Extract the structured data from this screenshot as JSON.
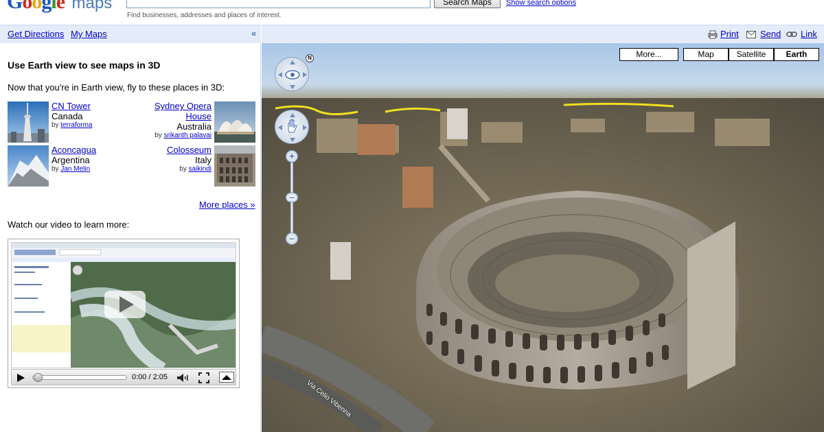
{
  "header": {
    "logo_google": "Google",
    "logo_maps": "maps",
    "search_value": "",
    "search_button": "Search Maps",
    "search_options": "Show search options",
    "search_hint": "Find businesses, addresses and places of interest."
  },
  "panel_bar": {
    "get_directions": "Get Directions",
    "my_maps": "My Maps",
    "collapse": "«"
  },
  "panel": {
    "title": "Use Earth view to see maps in 3D",
    "intro": "Now that you're in Earth view, fly to these places in 3D:",
    "places": [
      {
        "name": "CN Tower",
        "country": "Canada",
        "by_prefix": "by",
        "author": "terraforma"
      },
      {
        "name": "Sydney Opera House",
        "country": "Australia",
        "by_prefix": "by",
        "author": "srikanth palavai"
      },
      {
        "name": "Aconcagua",
        "country": "Argentina",
        "by_prefix": "by",
        "author": "Jan Melin"
      },
      {
        "name": "Colosseum",
        "country": "Italy",
        "by_prefix": "by",
        "author": "saikindi"
      }
    ],
    "more_places": "More places »",
    "video_label": "Watch our video to learn more:",
    "video_time": "0:00 / 2:05"
  },
  "map_toolbar": {
    "print": "Print",
    "send": "Send",
    "link": "Link"
  },
  "map": {
    "more_button": "More...",
    "types": [
      "Map",
      "Satellite",
      "Earth"
    ],
    "active_type": "Earth",
    "street_label": "Via Celio Vibenna",
    "compass_label": "N"
  },
  "colors": {
    "panel_bar_bg": "#e5ecf9",
    "link": "#0000cc",
    "route_yellow": "#f0e020"
  }
}
